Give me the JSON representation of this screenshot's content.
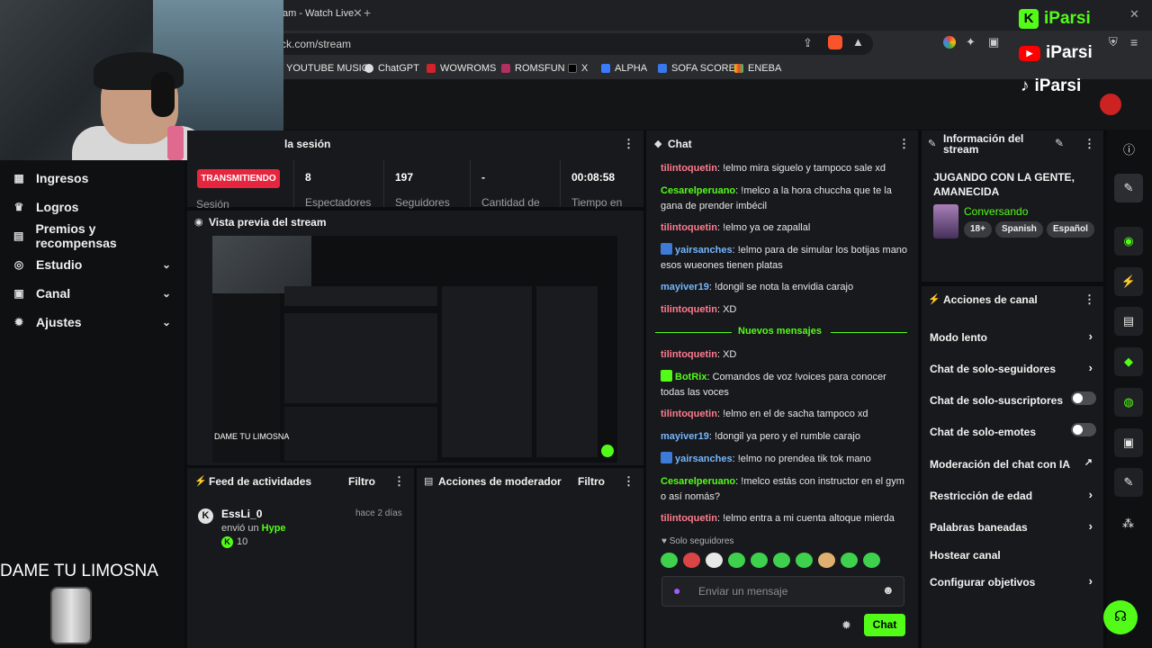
{
  "browser": {
    "tab_title": "am - Watch Live",
    "url": "ck.com/stream",
    "bookmarks": [
      "YOUTUBE MUSIC",
      "ChatGPT",
      "WOWROMS",
      "ROMSFUN",
      "X",
      "ALPHA",
      "SOFA SCORE",
      "ENEBA"
    ]
  },
  "overlay": {
    "logo_k": "iParsi",
    "logo_yt": "iParsi",
    "logo_tt": "iParsi",
    "donation_text": "DAME TU LIMOSNA"
  },
  "sidebar": {
    "items": [
      {
        "label": "Ingresos",
        "icon": "chart-icon",
        "expandable": false
      },
      {
        "label": "Logros",
        "icon": "trophy-icon",
        "expandable": false
      },
      {
        "label": "Premios y recompensas",
        "icon": "gift-icon",
        "expandable": false
      },
      {
        "label": "Estudio",
        "icon": "studio-icon",
        "expandable": true
      },
      {
        "label": "Canal",
        "icon": "channel-icon",
        "expandable": true
      },
      {
        "label": "Ajustes",
        "icon": "gear-icon",
        "expandable": true
      }
    ]
  },
  "session": {
    "title": "la sesión",
    "status": "TRANSMITIENDO",
    "status_sub": "Sesión",
    "stats": [
      {
        "value": "8",
        "label": "Espectadores"
      },
      {
        "value": "197",
        "label": "Seguidores"
      },
      {
        "value": "-",
        "label": "Cantidad de"
      },
      {
        "value": "00:08:58",
        "label": "Tiempo en"
      }
    ]
  },
  "preview": {
    "title": "Vista previa del stream"
  },
  "activity": {
    "title": "Feed de actividades",
    "filter": "Filtro",
    "item": {
      "user": "EssLi_0",
      "time": "hace 2 días",
      "action": "envió un",
      "highlight": "Hype",
      "amount": "10"
    }
  },
  "modactions": {
    "title": "Acciones de moderador",
    "filter": "Filtro"
  },
  "chat": {
    "title": "Chat",
    "messages_before": [
      {
        "user": "tilintoquetin",
        "color": "#ff7b8f",
        "text": "!elmo mira siguelo y tampoco sale xd",
        "badge": false
      },
      {
        "user": "Cesarelperuano",
        "color": "#53fc18",
        "text": "!melco a la hora chuccha que te la gana de prender imbécil",
        "badge": false
      },
      {
        "user": "tilintoquetin",
        "color": "#ff7b8f",
        "text": "!elmo ya oe zapallal",
        "badge": false
      },
      {
        "user": "yairsanches",
        "color": "#75b7ff",
        "text": "!elmo para de simular los botijas mano esos wueones tienen platas",
        "badge": true
      },
      {
        "user": "mayiver19",
        "color": "#75b7ff",
        "text": "!dongil se nota la envidia carajo",
        "badge": false
      },
      {
        "user": "tilintoquetin",
        "color": "#ff7b8f",
        "text": "XD",
        "badge": false
      }
    ],
    "new_messages_label": "Nuevos mensajes",
    "messages_after": [
      {
        "user": "tilintoquetin",
        "color": "#ff7b8f",
        "text": "XD",
        "badge": false
      },
      {
        "user": "BotRix",
        "color": "#53fc18",
        "text": "Comandos de voz !voices para conocer todas las voces",
        "badge": true
      },
      {
        "user": "tilintoquetin",
        "color": "#ff7b8f",
        "text": "!elmo en el de sacha tampoco xd",
        "badge": false
      },
      {
        "user": "mayiver19",
        "color": "#75b7ff",
        "text": "!dongil ya pero y el rumble carajo",
        "badge": false
      },
      {
        "user": "yairsanches",
        "color": "#75b7ff",
        "text": "!elmo no prendea tik tok mano",
        "badge": true
      },
      {
        "user": "Cesarelperuano",
        "color": "#53fc18",
        "text": "!melco estás con instructor en el gym o así nomás?",
        "badge": false
      },
      {
        "user": "tilintoquetin",
        "color": "#ff7b8f",
        "text": "!elmo entra a mi cuenta altoque mierda",
        "badge": false
      }
    ],
    "followers_only": "Solo seguidores",
    "input_placeholder": "Enviar un mensaje",
    "send_label": "Chat"
  },
  "info": {
    "title": "Información del stream",
    "stream_title": "JUGANDO CON LA GENTE, AMANECIDA",
    "category": "Conversando",
    "tags": [
      "18+",
      "Spanish",
      "Español"
    ]
  },
  "channel_actions": {
    "title": "Acciones de canal",
    "items": [
      {
        "label": "Modo lento",
        "kind": "chevron"
      },
      {
        "label": "Chat de solo-seguidores",
        "kind": "chevron"
      },
      {
        "label": "Chat de solo-suscriptores",
        "kind": "toggle"
      },
      {
        "label": "Chat de solo-emotes",
        "kind": "toggle"
      },
      {
        "label": "Moderación del chat con IA",
        "kind": "external"
      },
      {
        "label": "Restricción de edad",
        "kind": "chevron"
      },
      {
        "label": "Palabras baneadas",
        "kind": "chevron"
      },
      {
        "label": "Hostear canal",
        "kind": "none"
      },
      {
        "label": "Configurar objetivos",
        "kind": "chevron"
      }
    ]
  },
  "colors": {
    "accent": "#53fc18",
    "live": "#e6263f",
    "panel": "#18191c"
  }
}
